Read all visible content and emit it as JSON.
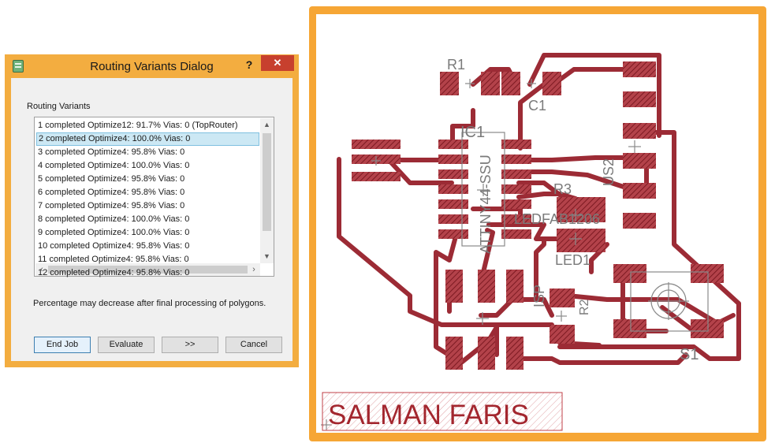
{
  "dialog": {
    "title": "Routing Variants Dialog",
    "help_label": "?",
    "close_label": "✕",
    "group_label": "Routing Variants",
    "items": [
      {
        "label": "1 completed Optimize12:   91.7%  Vias: 0 (TopRouter)",
        "selected": false
      },
      {
        "label": "2 completed Optimize4:  100.0%  Vias: 0",
        "selected": true
      },
      {
        "label": "3 completed Optimize4:    95.8%  Vias: 0",
        "selected": false
      },
      {
        "label": "4 completed Optimize4:  100.0%  Vias: 0",
        "selected": false
      },
      {
        "label": "5 completed Optimize4:    95.8%  Vias: 0",
        "selected": false
      },
      {
        "label": "6 completed Optimize4:    95.8%  Vias: 0",
        "selected": false
      },
      {
        "label": "7 completed Optimize4:    95.8%  Vias: 0",
        "selected": false
      },
      {
        "label": "8 completed Optimize4:  100.0%  Vias: 0",
        "selected": false
      },
      {
        "label": "9 completed Optimize4:  100.0%  Vias: 0",
        "selected": false
      },
      {
        "label": "10 completed Optimize4:   95.8%  Vias: 0",
        "selected": false
      },
      {
        "label": "11 completed Optimize4:   95.8%  Vias: 0",
        "selected": false
      },
      {
        "label": "12 completed Optimize4:   95.8%  Vias: 0",
        "selected": false
      }
    ],
    "note": "Percentage may decrease after final processing of polygons.",
    "buttons": {
      "end_job": "End Job",
      "evaluate": "Evaluate",
      "next": ">>",
      "cancel": "Cancel"
    }
  },
  "board": {
    "labels": {
      "r1": "R1",
      "c1": "C1",
      "ic1": "IC1",
      "ic1_value": "ATTINY44-SSU",
      "us2": "US2",
      "r3": "R3",
      "ledfab": "LEDFAB1206",
      "led1": "LED1",
      "isp": "ISP",
      "r2": "R2",
      "s1": "S1",
      "nameplate": "SALMAN FARIS"
    },
    "colors": {
      "frame": "#f6a635",
      "copper": "#9c2b35",
      "pad": "#a3262e"
    }
  }
}
